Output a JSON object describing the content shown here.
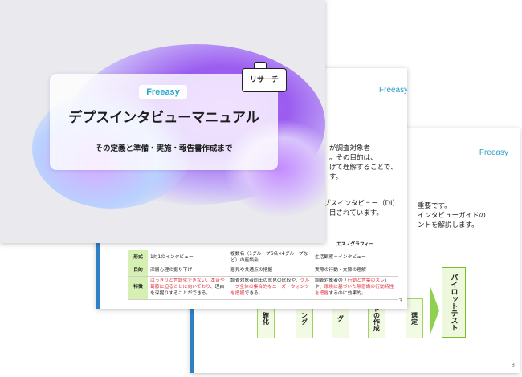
{
  "back_slide": {
    "logo": "Freeasy",
    "page_number": "8",
    "intro_lines": [
      "重要です。",
      "インタビューガイドの",
      "ントを解説します。"
    ],
    "flow_steps": [
      "確化",
      "ング",
      "グ",
      "ドの作成",
      "選定"
    ],
    "final_step": "パイロットテスト"
  },
  "middle_slide": {
    "logo": "Freeasy",
    "page_number": "3",
    "text_lines": [
      "が調査対象者",
      "。その目的は、",
      "げて理解することで、",
      "す。"
    ],
    "di_line1": "プスインタビュー（DI）",
    "di_line2": "目されています。",
    "table": {
      "header_right": "エスノグラフィー",
      "rows": [
        {
          "label": "形式",
          "c1": "1対1のインタビュー",
          "c2": "複数名（1グループ6名×4グループなど）の座談会",
          "c3": "生活観察＋インタビュー"
        },
        {
          "label": "目的",
          "c1": "深層心理の掘り下げ",
          "c2": "意見や共通点の把握",
          "c3": "実際の行動・文脈の理解"
        },
        {
          "label": "特徴",
          "c1_red": "はっきりと言語化できない、本音や葛藤に迫ることに向いており、",
          "c1": "理由を深掘りすることができる。",
          "c2_pre": "調査対象者同士の意見の比較や、",
          "c2_red": "グループ全体の集合的なニーズ・ウォンツを把握",
          "c2_post": "できる。",
          "c3_pre": "調査対象者の「",
          "c3_red": "行動と言葉のズレ",
          "c3_mid": "」や、",
          "c3_red2": "環境に基づいた無意識の行動特性を把握",
          "c3_post": "するのに効果的。"
        }
      ]
    }
  },
  "front_slide": {
    "logo": "Freeasy",
    "title": "デプスインタビューマニュアル",
    "subtitle": "その定義と準備・実施・報告書作成まで",
    "tag": "リサーチ"
  }
}
